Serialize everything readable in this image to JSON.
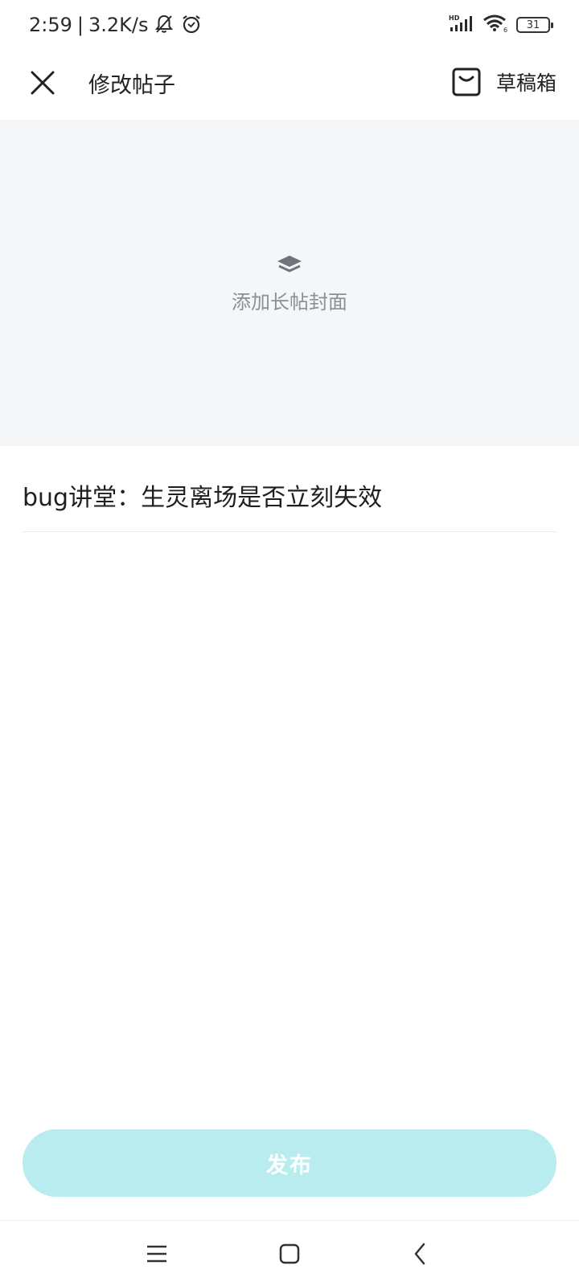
{
  "status_bar": {
    "time": "2:59",
    "separator": "|",
    "speed": "3.2K/s",
    "network_badge": "HD",
    "wifi_badge": "6",
    "battery": "31"
  },
  "header": {
    "title": "修改帖子",
    "drafts_label": "草稿箱"
  },
  "cover": {
    "label": "添加长帖封面"
  },
  "post": {
    "title": "bug讲堂：生灵离场是否立刻失效",
    "content": ""
  },
  "publish": {
    "label": "发布"
  },
  "colors": {
    "accent_disabled": "#b8ecee",
    "cover_bg": "#f5f6f8",
    "muted_text": "#8c8f96"
  }
}
